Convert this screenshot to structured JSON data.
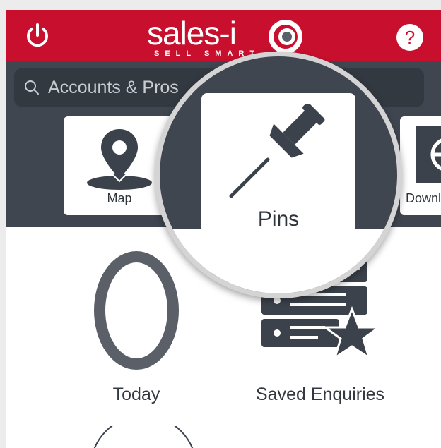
{
  "header": {
    "brand_name": "sales-i",
    "brand_tagline": "SELL SMART",
    "help_label": "?"
  },
  "search": {
    "placeholder": "Accounts & Pros"
  },
  "toolbar": {
    "tiles": [
      {
        "label": "Map"
      },
      {
        "label": "Pins"
      },
      {
        "label": "Downl"
      }
    ]
  },
  "widgets": {
    "today": {
      "value": "0",
      "label": "Today"
    },
    "saved": {
      "label": "Saved Enquiries"
    }
  },
  "colors": {
    "brand_red": "#c8102e",
    "toolbar_dark": "#3f4650",
    "icon_dark": "#3c424b"
  }
}
